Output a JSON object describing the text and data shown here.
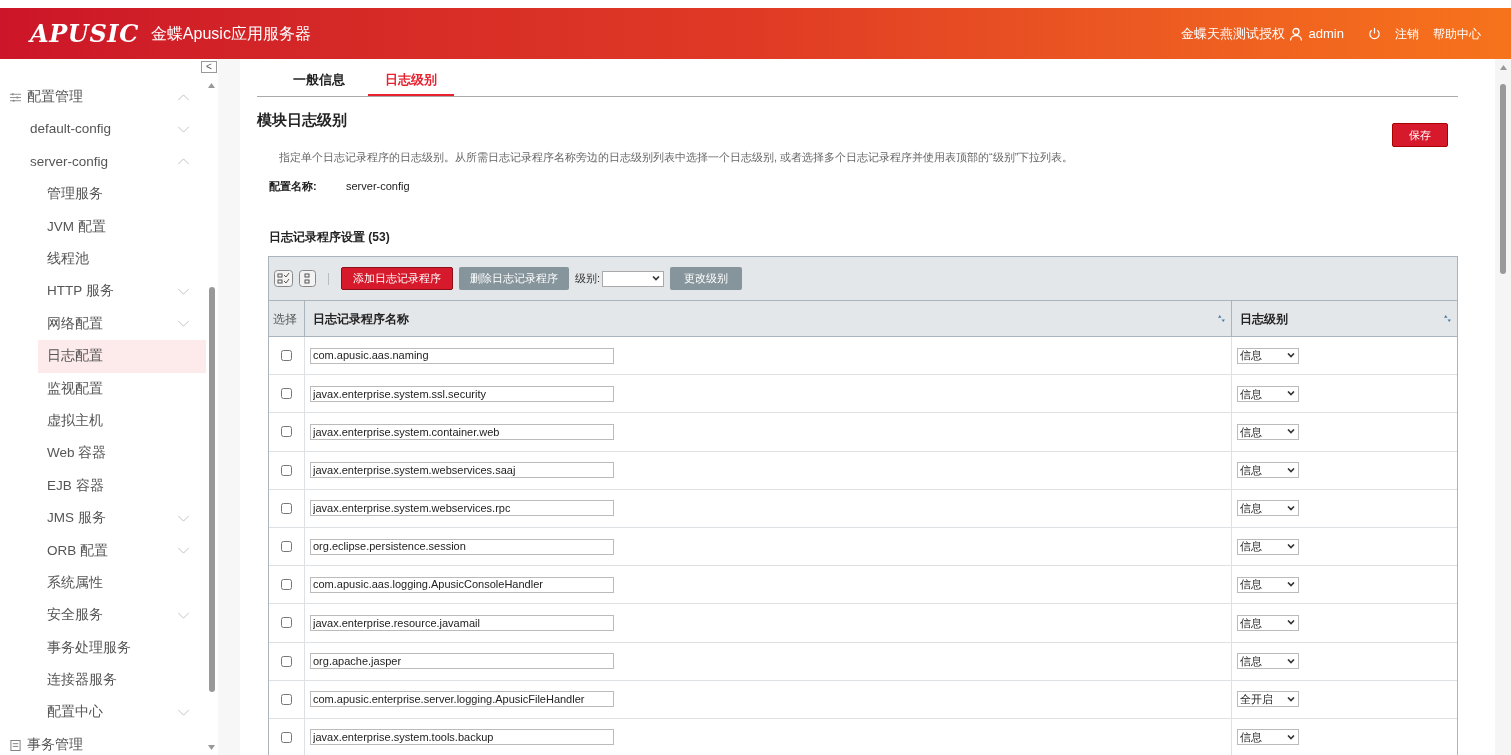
{
  "header": {
    "logo": "APUSIC",
    "product": "金蝶Apusic应用服务器",
    "license": "金蝶天燕测试授权",
    "user": "admin",
    "logout": "注销",
    "help": "帮助中心"
  },
  "sidebar": {
    "collapse": "<",
    "items": [
      {
        "label": "配置管理",
        "expanded": true,
        "selected": false,
        "children": [
          {
            "label": "default-config",
            "expanded": false,
            "selected": false
          },
          {
            "label": "server-config",
            "expanded": true,
            "selected": false,
            "children": [
              {
                "label": "管理服务",
                "selected": false
              },
              {
                "label": "JVM 配置",
                "selected": false
              },
              {
                "label": "线程池",
                "selected": false
              },
              {
                "label": "HTTP 服务",
                "expanded": false,
                "selected": false
              },
              {
                "label": "网络配置",
                "expanded": false,
                "selected": false
              },
              {
                "label": "日志配置",
                "selected": true
              },
              {
                "label": "监视配置",
                "selected": false
              },
              {
                "label": "虚拟主机",
                "selected": false
              },
              {
                "label": "Web 容器",
                "selected": false
              },
              {
                "label": "EJB 容器",
                "selected": false
              },
              {
                "label": "JMS 服务",
                "expanded": false,
                "selected": false
              },
              {
                "label": "ORB 配置",
                "expanded": false,
                "selected": false
              },
              {
                "label": "系统属性",
                "selected": false
              },
              {
                "label": "安全服务",
                "expanded": false,
                "selected": false
              },
              {
                "label": "事务处理服务",
                "selected": false
              },
              {
                "label": "连接器服务",
                "selected": false
              },
              {
                "label": "配置中心",
                "expanded": false,
                "selected": false
              }
            ]
          }
        ]
      },
      {
        "label": "事务管理",
        "selected": false
      }
    ]
  },
  "tabs": [
    {
      "label": "一般信息",
      "selected": false
    },
    {
      "label": "日志级别",
      "selected": true
    }
  ],
  "page": {
    "title": "模块日志级别",
    "save": "保存",
    "description": "指定单个日志记录程序的日志级别。从所需日志记录程序名称旁边的日志级别列表中选择一个日志级别, 或者选择多个日志记录程序并使用表顶部的“级别”下拉列表。",
    "config_label": "配置名称:",
    "config_value": "server-config",
    "section_title": "日志记录程序设置 (53)"
  },
  "toolbar": {
    "add": "添加日志记录程序",
    "delete": "删除日志记录程序",
    "level_label": "级别:",
    "change": "更改级别"
  },
  "table": {
    "columns": [
      "选择",
      "日志记录程序名称",
      "日志级别"
    ],
    "rows": [
      {
        "checked": false,
        "name": "com.apusic.aas.naming",
        "level": "信息"
      },
      {
        "checked": false,
        "name": "javax.enterprise.system.ssl.security",
        "level": "信息"
      },
      {
        "checked": false,
        "name": "javax.enterprise.system.container.web",
        "level": "信息"
      },
      {
        "checked": false,
        "name": "javax.enterprise.system.webservices.saaj",
        "level": "信息"
      },
      {
        "checked": false,
        "name": "javax.enterprise.system.webservices.rpc",
        "level": "信息"
      },
      {
        "checked": false,
        "name": "org.eclipse.persistence.session",
        "level": "信息"
      },
      {
        "checked": false,
        "name": "com.apusic.aas.logging.ApusicConsoleHandler",
        "level": "信息"
      },
      {
        "checked": false,
        "name": "javax.enterprise.resource.javamail",
        "level": "信息"
      },
      {
        "checked": false,
        "name": "org.apache.jasper",
        "level": "信息"
      },
      {
        "checked": false,
        "name": "com.apusic.enterprise.server.logging.ApusicFileHandler",
        "level": "全开启"
      },
      {
        "checked": false,
        "name": "javax.enterprise.system.tools.backup",
        "level": "信息"
      }
    ]
  }
}
